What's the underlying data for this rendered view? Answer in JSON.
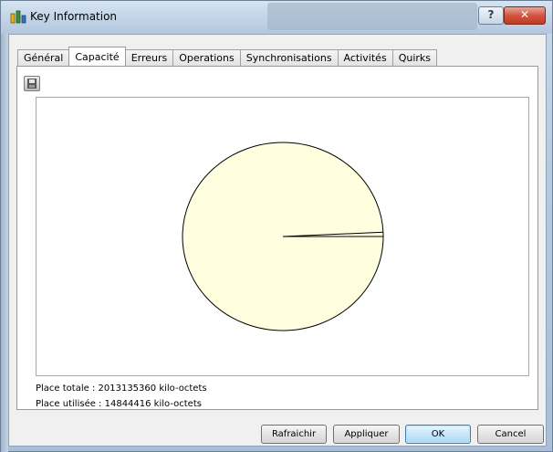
{
  "window": {
    "title": "Key Information",
    "help_label": "?",
    "close_label": "✕"
  },
  "tabs": [
    {
      "label": "Général"
    },
    {
      "label": "Capacité"
    },
    {
      "label": "Erreurs"
    },
    {
      "label": "Operations"
    },
    {
      "label": "Synchronisations"
    },
    {
      "label": "Activités"
    },
    {
      "label": "Quirks"
    }
  ],
  "active_tab": "Capacité",
  "toolbar": {
    "save_icon": "save-icon"
  },
  "chart": {
    "fill_color": "#ffffe0",
    "outline_color": "#000000"
  },
  "chart_data": {
    "type": "pie",
    "slices": [
      {
        "value": 14844416
      },
      {
        "value": 2013135360
      }
    ]
  },
  "info": {
    "total": "Place totale : 2013135360 kilo-octets",
    "used": "Place utilisée : 14844416 kilo-octets"
  },
  "buttons": {
    "refresh": "Rafraichir",
    "apply": "Appliquer",
    "ok": "OK",
    "cancel": "Cancel"
  }
}
